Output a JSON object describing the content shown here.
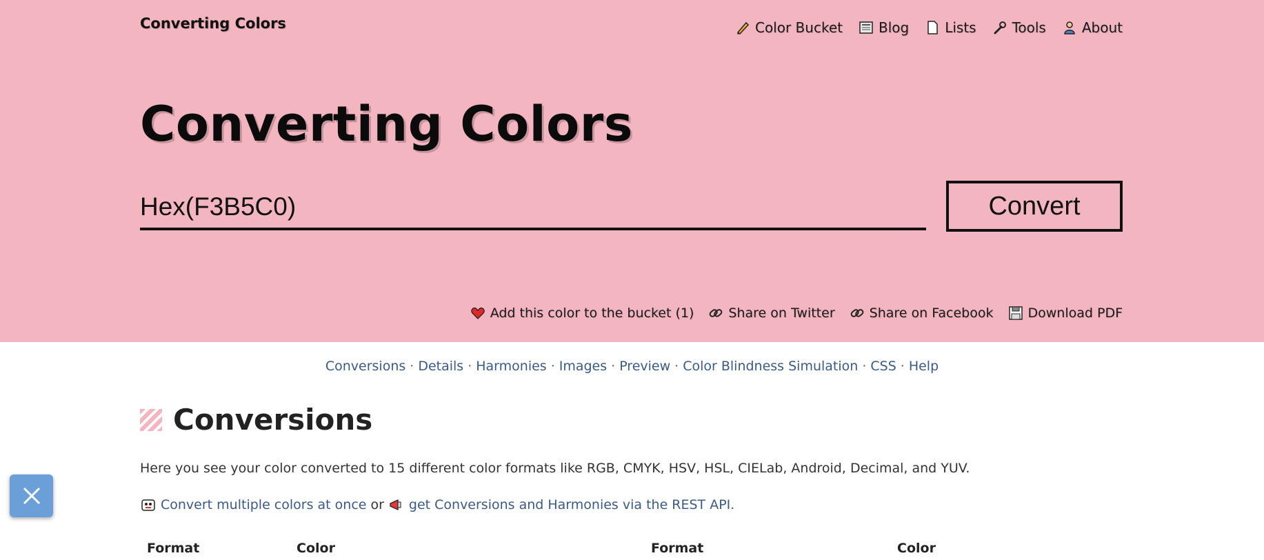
{
  "header": {
    "brand": "Converting Colors",
    "nav": [
      {
        "label": "Color Bucket",
        "icon": "pencil-icon"
      },
      {
        "label": "Blog",
        "icon": "newspaper-icon"
      },
      {
        "label": "Lists",
        "icon": "document-icon"
      },
      {
        "label": "Tools",
        "icon": "wrench-icon"
      },
      {
        "label": "About",
        "icon": "person-icon"
      }
    ]
  },
  "hero": {
    "title": "Converting Colors",
    "input_value": "Hex(F3B5C0)",
    "convert_label": "Convert",
    "background": "#F3B5C0",
    "actions": [
      {
        "label": "Add this color to the bucket (1)",
        "icon": "heart-icon"
      },
      {
        "label": "Share on Twitter",
        "icon": "link-icon"
      },
      {
        "label": "Share on Facebook",
        "icon": "link-icon"
      },
      {
        "label": "Download PDF",
        "icon": "floppy-icon"
      }
    ]
  },
  "subnav": [
    "Conversions",
    "Details",
    "Harmonies",
    "Images",
    "Preview",
    "Color Blindness Simulation",
    "CSS",
    "Help"
  ],
  "conversions": {
    "title": "Conversions",
    "intro": "Here you see your color converted to 15 different color formats like RGB, CMYK, HSV, HSL, CIELab, Android, Decimal, and YUV.",
    "link1": "Convert multiple colors at once",
    "or_text": "or",
    "link2": "get Conversions and Harmonies via the REST API.",
    "table_headers": [
      "Format",
      "Color",
      "Format",
      "Color"
    ]
  },
  "colors": {
    "accent": "#F3B5C0",
    "link": "#3a5a86",
    "fab": "#6a9fd8"
  }
}
